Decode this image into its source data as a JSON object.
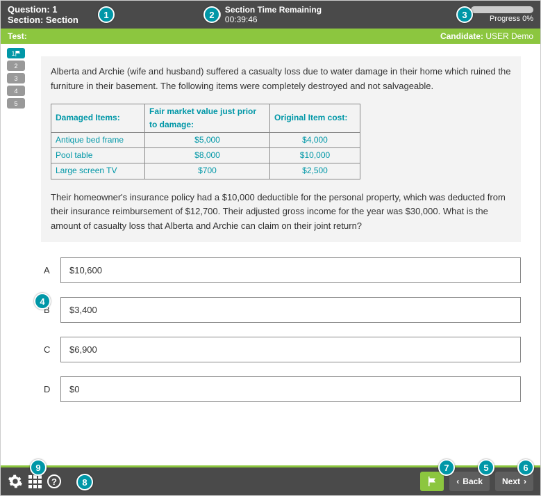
{
  "header": {
    "question_label": "Question:",
    "question_num": "1",
    "section_label": "Section:",
    "section_name": "Section",
    "timer_label": "Section Time Remaining",
    "timer_value": "00:39:46",
    "progress_text": "Progress 0%"
  },
  "greenbar": {
    "test_label": "Test:",
    "test_name": "",
    "candidate_label": "Candidate:",
    "candidate_name": "USER Demo"
  },
  "nav_items": [
    "1",
    "2",
    "3",
    "4",
    "5"
  ],
  "question": {
    "para1": "Alberta and Archie (wife and husband) suffered a casualty loss due to water damage in their home which ruined the furniture in their basement. The following items were completely destroyed and not salvageable.",
    "table": {
      "headers": [
        "Damaged Items:",
        "Fair market value just prior to damage:",
        "Original Item cost:"
      ],
      "rows": [
        [
          "Antique bed frame",
          "$5,000",
          "$4,000"
        ],
        [
          "Pool table",
          "$8,000",
          "$10,000"
        ],
        [
          "Large screen TV",
          "$700",
          "$2,500"
        ]
      ]
    },
    "para2": "Their homeowner's insurance policy had a $10,000 deductible for the personal property, which was deducted from their insurance reimbursement of $12,700. Their adjusted gross income for the year was $30,000. What is the amount of casualty loss that Alberta and Archie can claim on their joint return?",
    "options": [
      {
        "letter": "A",
        "text": "$10,600"
      },
      {
        "letter": "B",
        "text": "$3,400"
      },
      {
        "letter": "C",
        "text": "$6,900"
      },
      {
        "letter": "D",
        "text": "$0"
      }
    ]
  },
  "footer": {
    "back_label": "Back",
    "next_label": "Next"
  },
  "markers": {
    "m1": "1",
    "m2": "2",
    "m3": "3",
    "m4": "4",
    "m5": "5",
    "m6": "6",
    "m7": "7",
    "m8": "8",
    "m9": "9"
  }
}
